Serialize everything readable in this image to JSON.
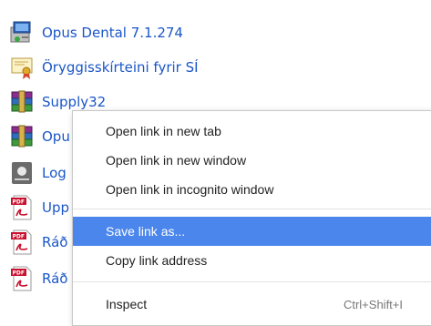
{
  "links": [
    {
      "label": "Opus Dental 7.1.274",
      "icon": "opus-installer-icon"
    },
    {
      "label": "Öryggisskírteini fyrir SÍ",
      "icon": "certificate-icon"
    },
    {
      "label": "Supply32",
      "icon": "winrar-archive-icon"
    },
    {
      "label": "Opu",
      "icon": "winrar-archive-icon"
    },
    {
      "label": "Log",
      "icon": "logo-box-icon"
    },
    {
      "label": "Upp",
      "icon": "pdf-icon"
    },
    {
      "label": "Ráð",
      "icon": "pdf-icon"
    },
    {
      "label": "Ráð",
      "icon": "pdf-icon"
    }
  ],
  "context_menu": {
    "items": [
      {
        "label": "Open link in new tab",
        "shortcut": ""
      },
      {
        "label": "Open link in new window",
        "shortcut": ""
      },
      {
        "label": "Open link in incognito window",
        "shortcut": ""
      },
      {
        "label": "Save link as...",
        "shortcut": ""
      },
      {
        "label": "Copy link address",
        "shortcut": ""
      },
      {
        "label": "Inspect",
        "shortcut": "Ctrl+Shift+I"
      }
    ],
    "highlighted_color": "#4b86ec"
  },
  "colors": {
    "link": "#1a56c8"
  }
}
